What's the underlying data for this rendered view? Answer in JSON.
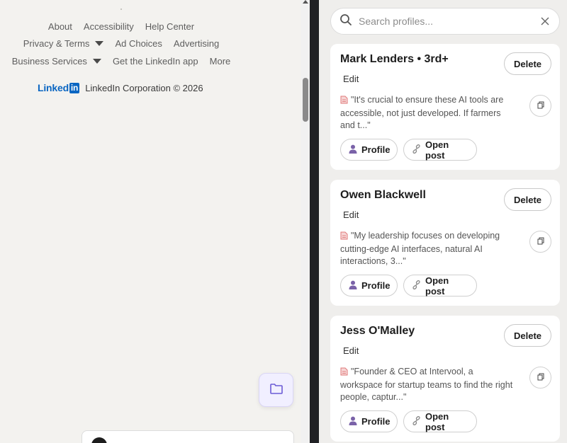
{
  "footer": {
    "row1": [
      "About",
      "Accessibility",
      "Help Center"
    ],
    "row2": {
      "privacy": "Privacy & Terms",
      "ad_choices": "Ad Choices",
      "advertising": "Advertising"
    },
    "row3": {
      "business": "Business Services",
      "get_app": "Get the LinkedIn app",
      "more": "More"
    },
    "logo_text": "Linked",
    "logo_in": "in",
    "copyright": "LinkedIn Corporation © 2026"
  },
  "panel": {
    "search_placeholder": "Search profiles...",
    "cards": [
      {
        "name": "Mark Lenders • 3rd+",
        "edit": "Edit",
        "delete": "Delete",
        "snippet": "\"It's crucial to ensure these AI tools are accessible, not just developed. If farmers and t...\"",
        "profile": "Profile",
        "open_post": "Open post"
      },
      {
        "name": "Owen Blackwell",
        "edit": "Edit",
        "delete": "Delete",
        "snippet": "\"My leadership focuses on developing cutting-edge AI interfaces, natural AI interactions, 3...\"",
        "profile": "Profile",
        "open_post": "Open post"
      },
      {
        "name": "Jess O'Malley",
        "edit": "Edit",
        "delete": "Delete",
        "snippet": "\"Founder & CEO at Intervool, a workspace for startup teams to find the right people, captur...\"",
        "profile": "Profile",
        "open_post": "Open post"
      }
    ]
  },
  "colors": {
    "linkedin_blue": "#0a66c2",
    "folder_accent": "#6b5bd6",
    "profile_icon": "#7a62a8",
    "note_icon": "#e07a7a"
  }
}
